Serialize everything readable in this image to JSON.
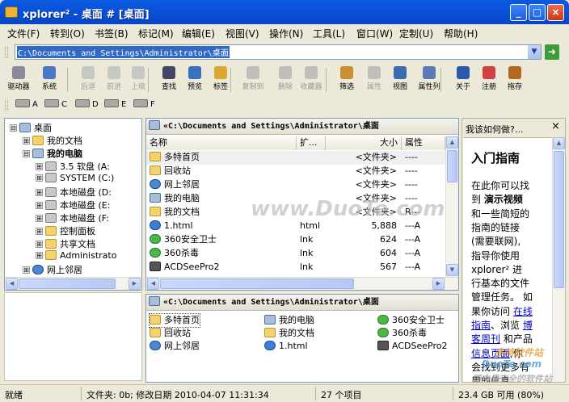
{
  "window": {
    "title": "xplorer² - 桌面 # [桌面]",
    "minimize": "_",
    "maximize": "□",
    "close": "×"
  },
  "menu": [
    "文件(F)",
    "转到(O)",
    "书签(B)",
    "标记(M)",
    "编辑(E)",
    "视图(V)",
    "操作(N)",
    "工具(L)",
    "窗口(W)",
    "定制(U)",
    "帮助(H)"
  ],
  "address": {
    "value": "C:\\Documents and Settings\\Administrator\\桌面",
    "go": "➜"
  },
  "toolbar": [
    {
      "label": "驱动器",
      "icon": "drive-icon",
      "disabled": false
    },
    {
      "label": "系统",
      "icon": "system-icon",
      "disabled": false
    },
    {
      "label": "后退",
      "icon": "back-icon",
      "disabled": true
    },
    {
      "label": "前进",
      "icon": "forward-icon",
      "disabled": true
    },
    {
      "label": "上级",
      "icon": "up-icon",
      "disabled": true
    },
    {
      "label": "查找",
      "icon": "find-icon",
      "disabled": false
    },
    {
      "label": "预览",
      "icon": "preview-icon",
      "disabled": false
    },
    {
      "label": "标签",
      "icon": "tag-icon",
      "disabled": false
    },
    {
      "label": "复制到",
      "icon": "copy-to-icon",
      "disabled": true
    },
    {
      "label": "删除",
      "icon": "delete-icon",
      "disabled": true
    },
    {
      "label": "收藏器",
      "icon": "collector-icon",
      "disabled": true
    },
    {
      "label": "筛选",
      "icon": "filter-icon",
      "disabled": false
    },
    {
      "label": "属性",
      "icon": "properties-icon",
      "disabled": true
    },
    {
      "label": "视图",
      "icon": "view-icon",
      "disabled": false
    },
    {
      "label": "属性列",
      "icon": "columns-icon",
      "disabled": false
    },
    {
      "label": "关于",
      "icon": "about-icon",
      "disabled": false
    },
    {
      "label": "注册",
      "icon": "register-icon",
      "disabled": false
    },
    {
      "label": "拖存",
      "icon": "drag-save-icon",
      "disabled": false
    }
  ],
  "drives": [
    "A",
    "C",
    "D",
    "E",
    "F"
  ],
  "tree": [
    {
      "label": "桌面",
      "exp": "⊟",
      "level": 0,
      "icon": "desktop"
    },
    {
      "label": "我的文档",
      "exp": "⊞",
      "level": 1,
      "icon": "folder"
    },
    {
      "label": "我的电脑",
      "exp": "⊟",
      "level": 1,
      "icon": "pc",
      "bold": true
    },
    {
      "label": "3.5 软盘 (A:",
      "exp": "⊞",
      "level": 2,
      "icon": "disk"
    },
    {
      "label": "SYSTEM (C:)",
      "exp": "⊞",
      "level": 2,
      "icon": "disk"
    },
    {
      "label": "本地磁盘 (D:",
      "exp": "⊞",
      "level": 2,
      "icon": "disk"
    },
    {
      "label": "本地磁盘 (E:",
      "exp": "⊞",
      "level": 2,
      "icon": "disk"
    },
    {
      "label": "本地磁盘 (F:",
      "exp": "⊞",
      "level": 2,
      "icon": "disk"
    },
    {
      "label": "控制面板",
      "exp": "⊞",
      "level": 2,
      "icon": "folder"
    },
    {
      "label": "共享文档",
      "exp": "⊞",
      "level": 2,
      "icon": "folder"
    },
    {
      "label": "Administrato",
      "exp": "⊞",
      "level": 2,
      "icon": "folder"
    },
    {
      "label": "网上邻居",
      "exp": "⊞",
      "level": 1,
      "icon": "net"
    }
  ],
  "top_pane": {
    "path": "«C:\\Documents and Settings\\Administrator\\桌面",
    "columns": [
      "名称",
      "扩...",
      "大小",
      "属性"
    ],
    "rows": [
      {
        "name": "多特首页",
        "ext": "",
        "size": "<文件夹>",
        "attr": "----",
        "icon": "folder"
      },
      {
        "name": "回收站",
        "ext": "",
        "size": "<文件夹>",
        "attr": "----",
        "icon": "folder"
      },
      {
        "name": "网上邻居",
        "ext": "",
        "size": "<文件夹>",
        "attr": "----",
        "icon": "net"
      },
      {
        "name": "我的电脑",
        "ext": "",
        "size": "<文件夹>",
        "attr": "----",
        "icon": "pc"
      },
      {
        "name": "我的文档",
        "ext": "",
        "size": "<文件夹>",
        "attr": "R---",
        "icon": "folder"
      },
      {
        "name": "1.html",
        "ext": "html",
        "size": "5,888",
        "attr": "---A",
        "icon": "ie"
      },
      {
        "name": "360安全卫士",
        "ext": "lnk",
        "size": "624",
        "attr": "---A",
        "icon": "green"
      },
      {
        "name": "360杀毒",
        "ext": "lnk",
        "size": "604",
        "attr": "---A",
        "icon": "green"
      },
      {
        "name": "ACDSeePro2",
        "ext": "lnk",
        "size": "567",
        "attr": "---A",
        "icon": "exe"
      }
    ]
  },
  "bottom_pane": {
    "path": "«C:\\Documents and Settings\\Administrator\\桌面",
    "items": [
      {
        "name": "多特首页",
        "icon": "folder"
      },
      {
        "name": "我的电脑",
        "icon": "pc"
      },
      {
        "name": "360安全卫士",
        "icon": "green"
      },
      {
        "name": "回收站",
        "icon": "folder"
      },
      {
        "name": "我的文档",
        "icon": "folder"
      },
      {
        "name": "360杀毒",
        "icon": "green"
      },
      {
        "name": "网上邻居",
        "icon": "net"
      },
      {
        "name": "1.html",
        "icon": "ie"
      },
      {
        "name": "ACDSeePro2",
        "icon": "exe"
      }
    ]
  },
  "help": {
    "header": "我该如何做?...",
    "close": "×",
    "title": "入门指南",
    "lines": [
      {
        "parts": [
          {
            "t": "在此你可以找"
          }
        ]
      },
      {
        "parts": [
          {
            "t": "到 "
          },
          {
            "t": "演示视频",
            "bold": true
          }
        ]
      },
      {
        "parts": [
          {
            "t": "和一些简短的"
          }
        ]
      },
      {
        "parts": [
          {
            "t": "指南的链接"
          }
        ]
      },
      {
        "parts": [
          {
            "t": "(需要联网),"
          }
        ]
      },
      {
        "parts": [
          {
            "t": "指导你使用"
          }
        ]
      },
      {
        "parts": [
          {
            "t": "xplorer² 进"
          }
        ]
      },
      {
        "parts": [
          {
            "t": "行基本的文件"
          }
        ]
      },
      {
        "parts": [
          {
            "t": "管理任务。 如"
          }
        ]
      },
      {
        "parts": [
          {
            "t": "果你访问 "
          },
          {
            "t": "在线",
            "link": true
          }
        ]
      },
      {
        "parts": [
          {
            "t": "指南",
            "link": true
          },
          {
            "t": "、浏览 "
          },
          {
            "t": "博",
            "link": true
          }
        ]
      },
      {
        "parts": [
          {
            "t": "客周刊",
            "link": true
          },
          {
            "t": " 和产品"
          }
        ]
      },
      {
        "parts": [
          {
            "t": "信息页面",
            "link": true
          },
          {
            "t": ",你"
          }
        ]
      },
      {
        "parts": [
          {
            "t": "会找到更多有"
          }
        ]
      },
      {
        "parts": [
          {
            "t": "用的信息。"
          }
        ]
      }
    ]
  },
  "watermarks": {
    "center": "www.DuoTe.com",
    "br1": "多特软件站",
    "br2": "DuoTe.com",
    "br3": "国内最安全的软件站"
  },
  "status": {
    "ready": "就绪",
    "info": "文件夹: 0b; 修改日期 2010-04-07 11:31:34",
    "count": "27 个项目",
    "space": "23.4 GB 可用 (80%)"
  }
}
